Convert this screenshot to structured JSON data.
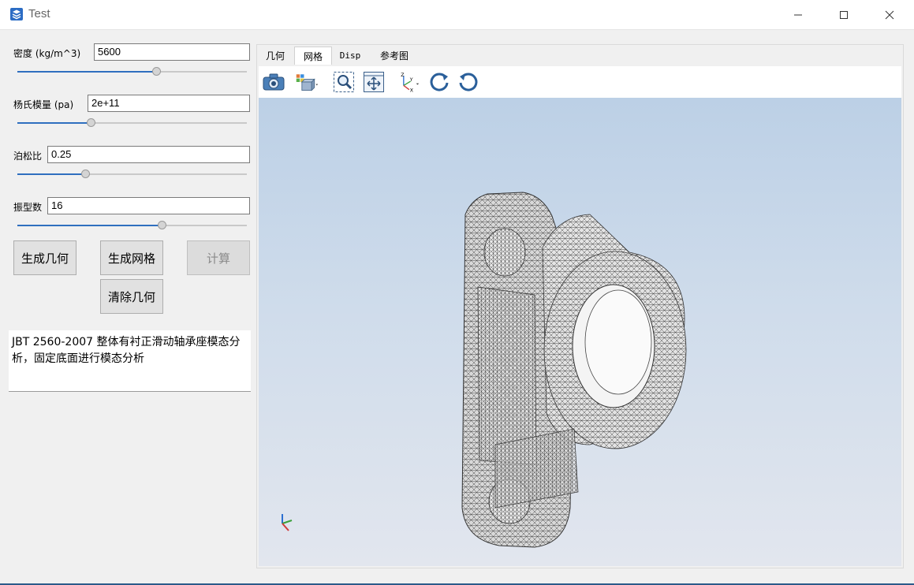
{
  "window": {
    "title": "Test",
    "app_icon": "app-icon",
    "controls": [
      "minimize-icon",
      "maximize-icon",
      "close-icon"
    ]
  },
  "params": {
    "density": {
      "label": "密度 (kg/m^3)",
      "value": "5600",
      "slider_fraction": 0.6
    },
    "youngs_modulus": {
      "label": "杨氏模量 (pa)",
      "value": "2e+11",
      "slider_fraction": 0.32
    },
    "poisson_ratio": {
      "label": "泊松比",
      "value": "0.25",
      "slider_fraction": 0.3
    },
    "mode_count": {
      "label": "振型数",
      "value": "16",
      "slider_fraction": 0.63
    }
  },
  "buttons": {
    "generate_geometry": "生成几何",
    "generate_mesh": "生成网格",
    "compute": "计算",
    "clear_geometry": "清除几何"
  },
  "description": "JBT 2560-2007 整体有衬正滑动轴承座模态分析，固定底面进行模态分析",
  "tabs": [
    {
      "label": "几何",
      "active": false
    },
    {
      "label": "网格",
      "active": true
    },
    {
      "label": "Disp",
      "active": false
    },
    {
      "label": "参考图",
      "active": false
    }
  ],
  "toolbar_icons": [
    "camera-icon",
    "view-cube-icon",
    "zoom-box-icon",
    "fit-all-icon",
    "axes-orientation-icon",
    "rotate-cw-icon",
    "rotate-ccw-icon"
  ],
  "viewport": {
    "content": "mesh-model",
    "background_top": "#bcd0e6",
    "background_bottom": "#e2e6ee",
    "triad_icon": "xyz-triad-icon"
  },
  "colors": {
    "accent": "#2f6fbf",
    "window_bg": "#f0f0f0"
  }
}
